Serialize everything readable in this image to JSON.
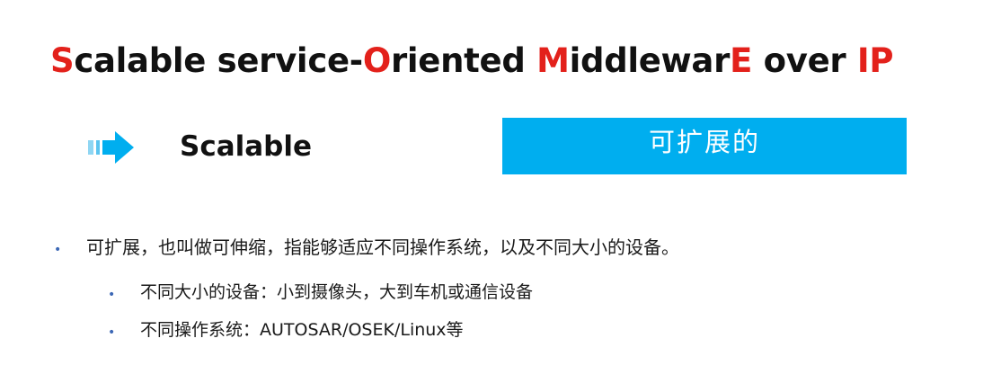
{
  "slide": {
    "title_parts": [
      {
        "text": "S",
        "highlight": true
      },
      {
        "text": "calable service-",
        "highlight": false
      },
      {
        "text": "O",
        "highlight": true
      },
      {
        "text": "riented ",
        "highlight": false
      },
      {
        "text": "M",
        "highlight": true
      },
      {
        "text": "iddlewar",
        "highlight": false
      },
      {
        "text": "E",
        "highlight": true
      },
      {
        "text": " over ",
        "highlight": false
      },
      {
        "text": "IP",
        "highlight": true
      }
    ],
    "term": {
      "icon": "arrow-right-icon",
      "label": "Scalable",
      "translation": "可扩展的"
    },
    "bullets": [
      {
        "text": "可扩展，也叫做可伸缩，指能够适应不同操作系统，以及不同大小的设备。"
      },
      {
        "text": "不同大小的设备：小到摄像头，大到车机或通信设备"
      },
      {
        "text": "不同操作系统：AUTOSAR/OSEK/Linux等"
      }
    ],
    "colors": {
      "highlight": "#e3211b",
      "accent_blue": "#00aeef",
      "bullet": "#3b67b5",
      "text": "#111111"
    }
  }
}
